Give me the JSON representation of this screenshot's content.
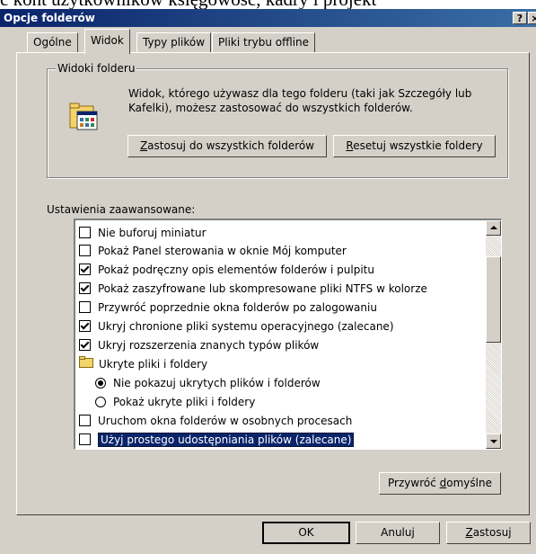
{
  "background_text": "ć kont użytkowników księgowość, kadry i projekt",
  "window": {
    "title": "Opcje folderów",
    "help_label": "?",
    "close_label": "×"
  },
  "tabs": [
    {
      "label": "Ogólne",
      "active": false
    },
    {
      "label": "Widok",
      "active": true
    },
    {
      "label": "Typy plików",
      "active": false
    },
    {
      "label": "Pliki trybu offline",
      "active": false
    }
  ],
  "folder_views": {
    "group_title": "Widoki folderu",
    "description": "Widok, którego używasz dla tego folderu (taki jak Szczegóły lub Kafelki), możesz zastosować do wszystkich folderów.",
    "apply_all": {
      "pre": "",
      "key": "Z",
      "post": "astosuj do wszystkich folderów"
    },
    "reset_all": {
      "pre": "",
      "key": "R",
      "post": "esetuj wszystkie foldery"
    }
  },
  "advanced": {
    "label": "Ustawienia zaawansowane:",
    "items": [
      {
        "type": "checkbox",
        "checked": false,
        "text": "Nie buforuj miniatur"
      },
      {
        "type": "checkbox",
        "checked": false,
        "text": "Pokaż Panel sterowania w oknie Mój komputer"
      },
      {
        "type": "checkbox",
        "checked": true,
        "text": "Pokaż podręczny opis elementów folderów i pulpitu"
      },
      {
        "type": "checkbox",
        "checked": true,
        "text": "Pokaż zaszyfrowane lub skompresowane pliki NTFS w kolorze"
      },
      {
        "type": "checkbox",
        "checked": false,
        "text": "Przywróć poprzednie okna folderów po zalogowaniu"
      },
      {
        "type": "checkbox",
        "checked": true,
        "text": "Ukryj chronione pliki systemu operacyjnego (zalecane)"
      },
      {
        "type": "checkbox",
        "checked": true,
        "text": "Ukryj rozszerzenia znanych typów plików"
      },
      {
        "type": "folder",
        "text": "Ukryte pliki i foldery"
      },
      {
        "type": "radio",
        "checked": true,
        "text": "Nie pokazuj ukrytych plików i folderów"
      },
      {
        "type": "radio",
        "checked": false,
        "text": "Pokaż ukryte pliki i foldery"
      },
      {
        "type": "checkbox",
        "checked": false,
        "text": "Uruchom okna folderów w osobnych procesach"
      },
      {
        "type": "checkbox",
        "checked": false,
        "text": "Użyj prostego udostępniania plików (zalecane)",
        "selected": true
      }
    ],
    "restore_defaults": {
      "pre": "Przywróć ",
      "key": "d",
      "post": "omyślne"
    }
  },
  "footer": {
    "ok": "OK",
    "cancel": "Anuluj",
    "apply": {
      "pre": "",
      "key": "Z",
      "post": "astosuj"
    }
  },
  "colors": {
    "face": "#d4d0c8",
    "title_start": "#0a246a",
    "title_end": "#3a6ea5",
    "selection": "#0a246a"
  }
}
